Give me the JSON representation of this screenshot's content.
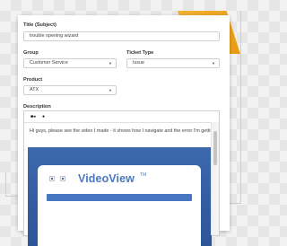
{
  "form": {
    "title_label": "Title (Subject)",
    "title_value": "trouble opening wizard",
    "group_label": "Group",
    "group_value": "Customer Service",
    "ticket_type_label": "Ticket Type",
    "ticket_type_value": "Issue",
    "product_label": "Product",
    "product_value": "ATX",
    "description_label": "Description",
    "description_text": "Hi guys, please see the video I made - it shows how I navigate and the error I'm getting."
  },
  "editor": {
    "toolbar": [
      "video-camera-icon",
      "record-icon"
    ],
    "embed": {
      "brand": "VideoView",
      "trademark": "TM"
    }
  },
  "colors": {
    "accent": "#f0a51e",
    "brand_blue": "#3d69ad",
    "text_dark": "#333333"
  }
}
